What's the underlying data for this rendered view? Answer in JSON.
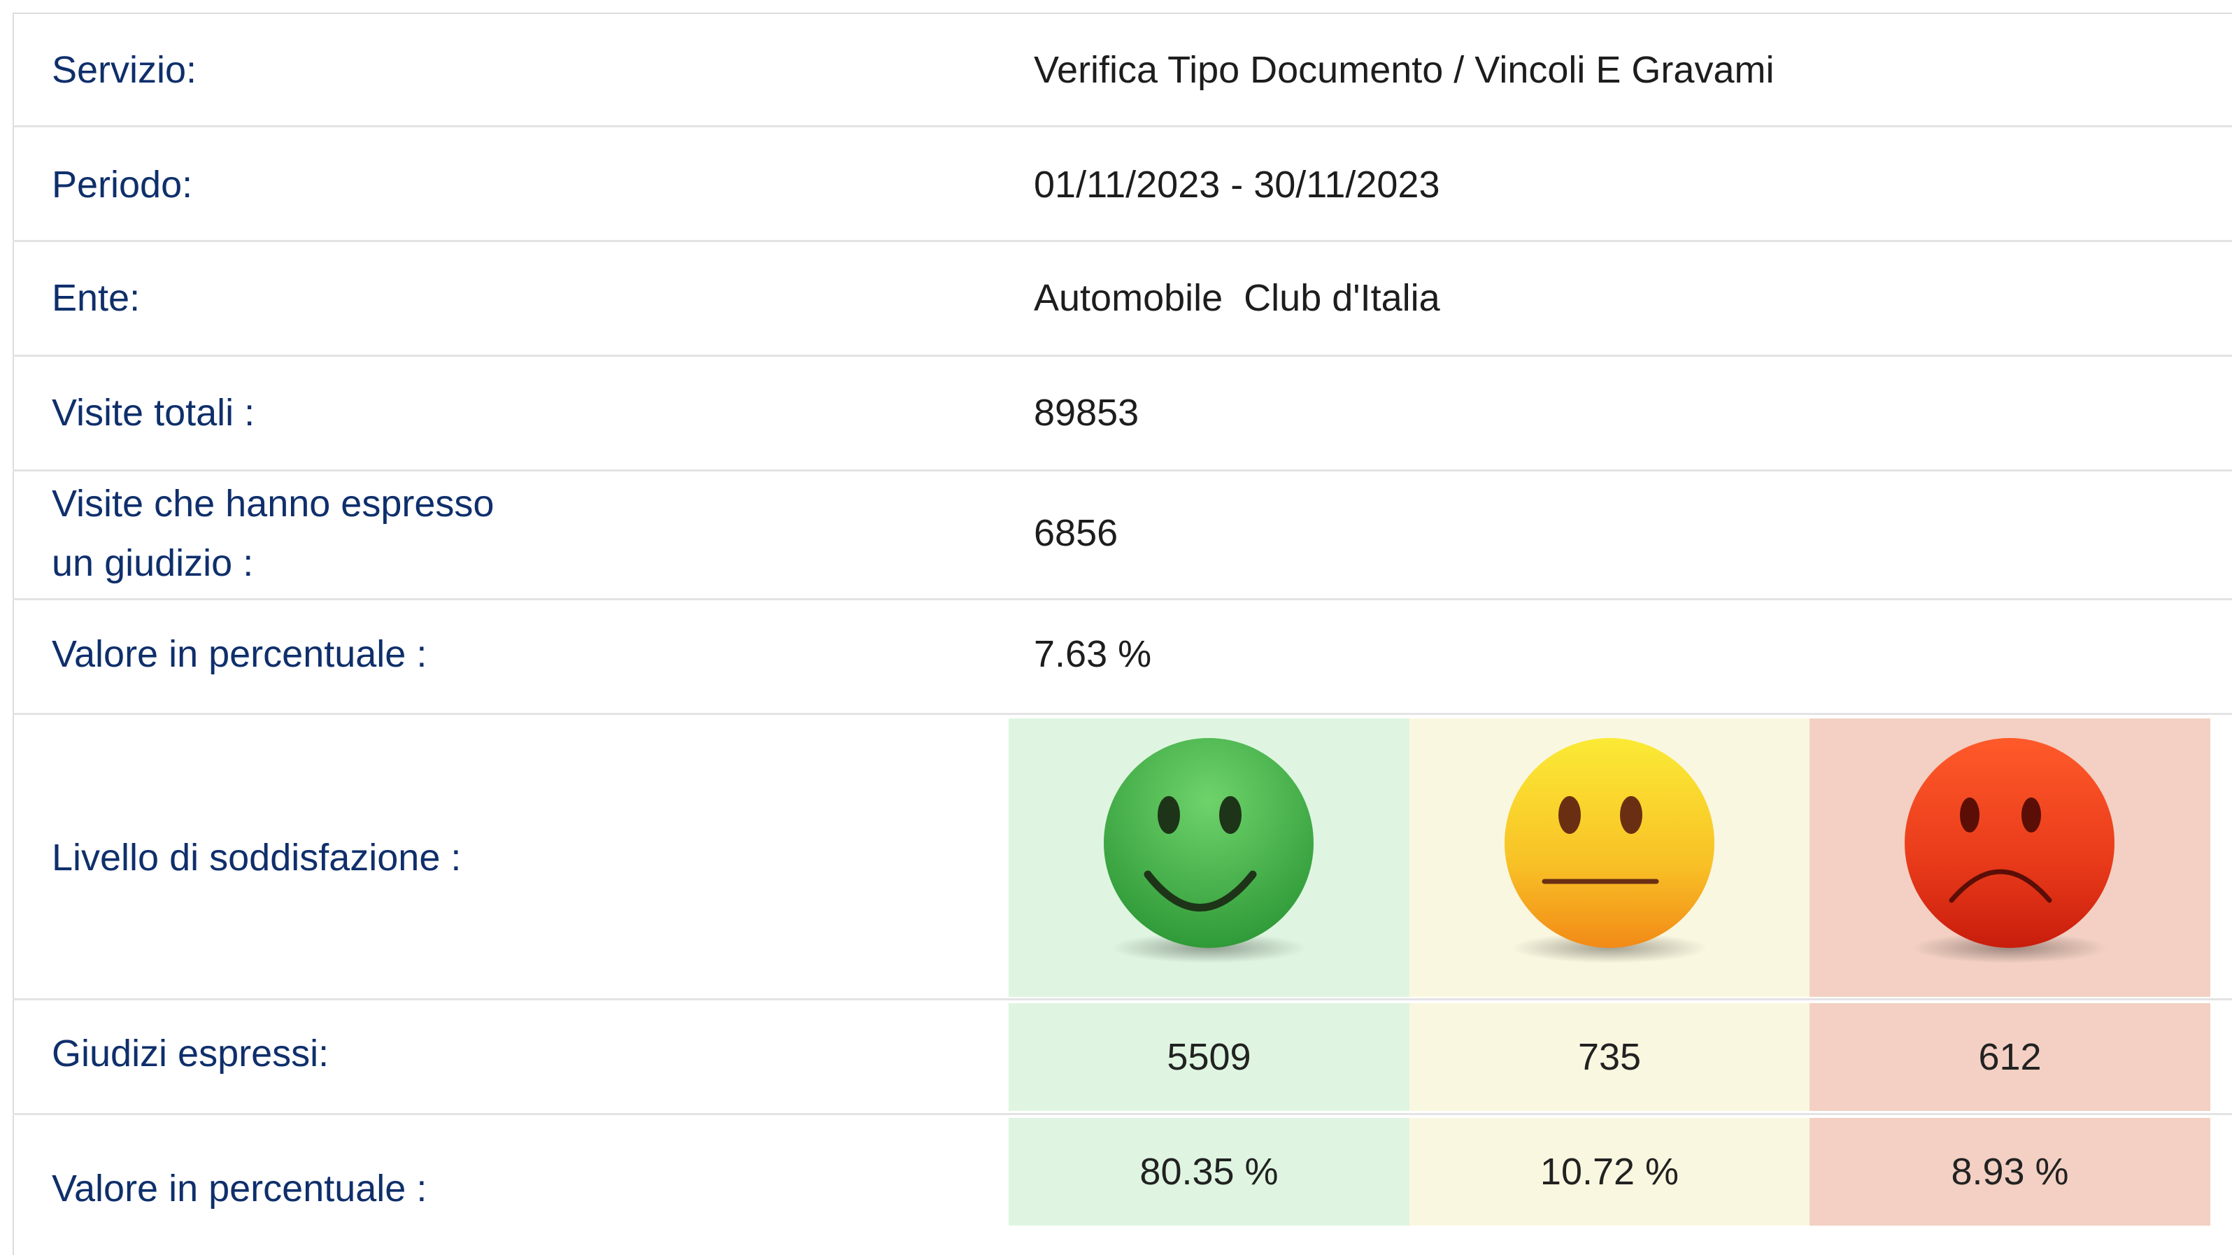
{
  "rows": {
    "servizio": {
      "label": "Servizio:",
      "value": "Verifica Tipo Documento / Vincoli E Gravami"
    },
    "periodo": {
      "label": "Periodo:",
      "value": "01/11/2023 - 30/11/2023"
    },
    "ente": {
      "label": "Ente:",
      "value": "Automobile  Club d'Italia"
    },
    "visite_totali": {
      "label": "Visite totali :",
      "value": "89853"
    },
    "visite_giudizio": {
      "label_line1": "Visite che hanno espresso",
      "label_line2": "un giudizio :",
      "value": "6856"
    },
    "percentuale": {
      "label": "Valore in percentuale :",
      "value": "7.63 %"
    },
    "soddisfazione": {
      "label": "Livello di soddisfazione :"
    },
    "giudizi": {
      "label": "Giudizi espressi:"
    },
    "percentuale_giudizi": {
      "label": "Valore in percentuale :"
    }
  },
  "ratings": [
    {
      "mood": "happy-face-icon",
      "count": "5509",
      "percent": "80.35 %",
      "count_value": 5509,
      "percent_value": 80.35,
      "bg": "#dff5e1"
    },
    {
      "mood": "neutral-face-icon",
      "count": "735",
      "percent": "10.72 %",
      "count_value": 735,
      "percent_value": 10.72,
      "bg": "#faf7e0"
    },
    {
      "mood": "sad-face-icon",
      "count": "612",
      "percent": "8.93 %",
      "count_value": 612,
      "percent_value": 8.93,
      "bg": "#f3d0c3"
    }
  ],
  "colors": {
    "label": "#0f2f6b",
    "happy_face": "#3fae45",
    "neutral_face": "#f6c825",
    "sad_face": "#e23a1a"
  }
}
